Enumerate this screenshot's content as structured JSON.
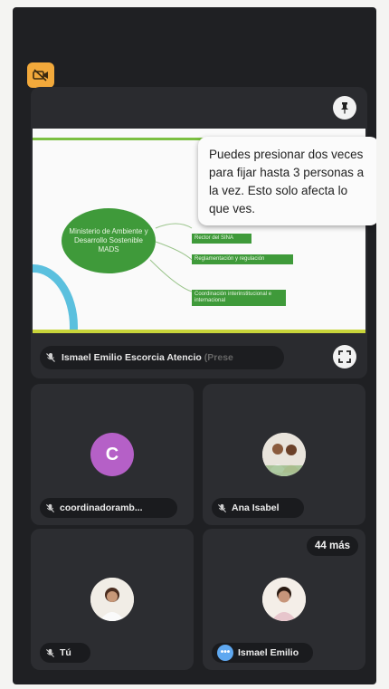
{
  "pinned": {
    "name": "Ismael Emilio Escorcia Atencio",
    "name_suffix": "(Prese",
    "tooltip": "Puedes presionar dos veces para fijar hasta 3 personas a la vez. Esto solo afecta lo que ves.",
    "slide": {
      "circle_text": "Ministerio de Ambiente y Desarrollo Sostenible MADS",
      "box1": "Rector del SINA",
      "box2": "Reglamentación y regulación",
      "box3": "Coordinación interinstitucional e internacional"
    }
  },
  "participants": [
    {
      "name": "coordinadoramb...",
      "avatar_letter": "C",
      "avatar_color": "#b560c7"
    },
    {
      "name": "Ana Isabel"
    },
    {
      "name": "Tú"
    },
    {
      "name": "Ismael Emilio"
    }
  ],
  "more_count_label": "44 más",
  "colors": {
    "camera_off_badge": "#f2a93b",
    "slide_green": "#3f9a3a",
    "avatar_purple": "#b560c7",
    "dots_blue": "#5fa8f0"
  }
}
